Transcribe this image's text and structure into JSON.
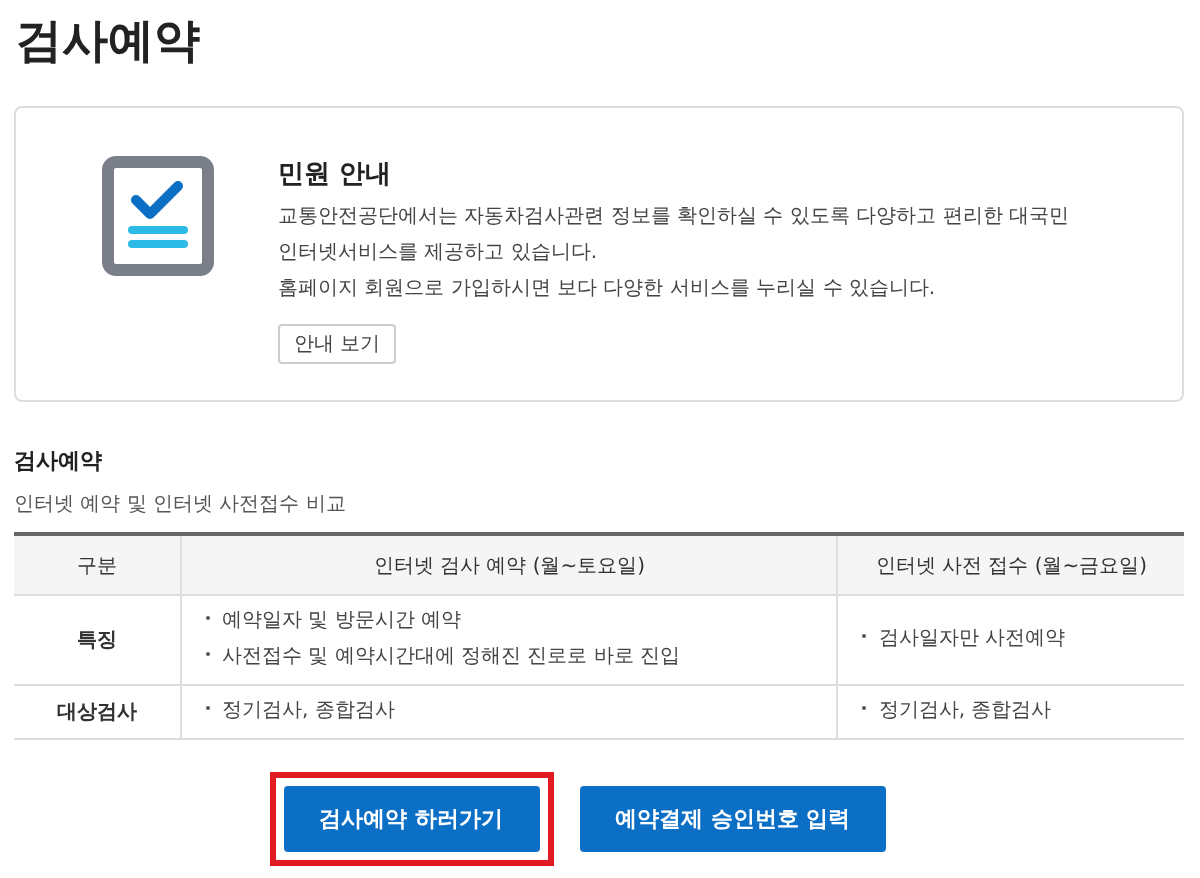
{
  "page_title": "검사예약",
  "info_card": {
    "title": "민원 안내",
    "lines": [
      "교통안전공단에서는 자동차검사관련 정보를 확인하실 수 있도록 다양하고 편리한 대국민",
      "인터넷서비스를 제공하고 있습니다.",
      "홈페이지 회원으로 가입하시면 보다 다양한 서비스를 누리실 수 있습니다."
    ],
    "button": "안내 보기"
  },
  "section": {
    "title": "검사예약",
    "subtitle": "인터넷 예약 및 인터넷 사전접수 비교"
  },
  "table": {
    "columns": [
      "구분",
      "인터넷 검사 예약 (월~토요일)",
      "인터넷 사전 접수 (월~금요일)"
    ],
    "rows": [
      [
        "특징",
        "예약일자 및 방문시간 예약\n사전접수 및 예약시간대에 정해진 진로로 바로 진입",
        "검사일자만 사전예약"
      ],
      [
        "대상검사",
        "정기검사, 종합검사",
        "정기검사, 종합검사"
      ]
    ]
  },
  "buttons": [
    {
      "label": "검사예약 하러가기",
      "highlighted": true
    },
    {
      "label": "예약결제 승인번호 입력",
      "highlighted": false
    }
  ]
}
